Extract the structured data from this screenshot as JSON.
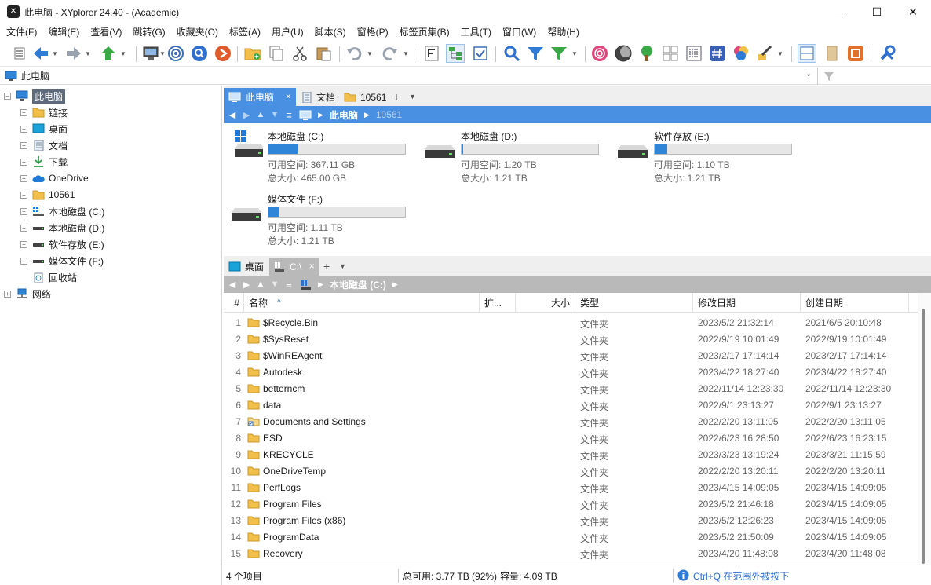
{
  "window": {
    "title": "此电脑 - XYplorer 24.40 - (Academic)",
    "min": "—",
    "max": "☐",
    "close": "✕"
  },
  "menu": [
    "文件(F)",
    "编辑(E)",
    "查看(V)",
    "跳转(G)",
    "收藏夹(O)",
    "标签(A)",
    "用户(U)",
    "脚本(S)",
    "窗格(P)",
    "标签页集(B)",
    "工具(T)",
    "窗口(W)",
    "帮助(H)"
  ],
  "address": {
    "text": "此电脑"
  },
  "tree": [
    {
      "label": "此电脑",
      "icon": "pc",
      "selected": true
    },
    {
      "label": "链接",
      "icon": "folder"
    },
    {
      "label": "桌面",
      "icon": "desktop"
    },
    {
      "label": "文档",
      "icon": "doc"
    },
    {
      "label": "下载",
      "icon": "download"
    },
    {
      "label": "OneDrive",
      "icon": "cloud"
    },
    {
      "label": "10561",
      "icon": "folder"
    },
    {
      "label": "本地磁盘 (C:)",
      "icon": "windrive"
    },
    {
      "label": "本地磁盘 (D:)",
      "icon": "drive"
    },
    {
      "label": "软件存放 (E:)",
      "icon": "drive"
    },
    {
      "label": "媒体文件 (F:)",
      "icon": "drive"
    },
    {
      "label": "回收站",
      "icon": "recycle"
    },
    {
      "label": "网络",
      "icon": "network"
    }
  ],
  "pane1": {
    "tabs": [
      "此电脑",
      "文档",
      "10561"
    ],
    "crumbs": [
      "此电脑",
      "10561"
    ],
    "drives": [
      {
        "name": "本地磁盘 (C:)",
        "free": "可用空间: 367.11 GB",
        "total": "总大小: 465.00 GB",
        "used": 0.21
      },
      {
        "name": "本地磁盘 (D:)",
        "free": "可用空间: 1.20 TB",
        "total": "总大小: 1.21 TB",
        "used": 0.01
      },
      {
        "name": "软件存放 (E:)",
        "free": "可用空间: 1.10 TB",
        "total": "总大小: 1.21 TB",
        "used": 0.09
      },
      {
        "name": "媒体文件 (F:)",
        "free": "可用空间: 1.11 TB",
        "total": "总大小: 1.21 TB",
        "used": 0.08
      }
    ]
  },
  "pane2": {
    "tabs": [
      "桌面",
      "C:\\"
    ],
    "crumbs": [
      "本地磁盘 (C:)"
    ],
    "columns": {
      "num": "#",
      "name": "名称",
      "ext": "扩...",
      "size": "大小",
      "type": "类型",
      "modified": "修改日期",
      "created": "创建日期"
    },
    "rows": [
      {
        "n": "1",
        "name": "$Recycle.Bin",
        "type": "文件夹",
        "mod": "2023/5/2 21:32:14",
        "cre": "2021/6/5 20:10:48"
      },
      {
        "n": "2",
        "name": "$SysReset",
        "type": "文件夹",
        "mod": "2022/9/19 10:01:49",
        "cre": "2022/9/19 10:01:49"
      },
      {
        "n": "3",
        "name": "$WinREAgent",
        "type": "文件夹",
        "mod": "2023/2/17 17:14:14",
        "cre": "2023/2/17 17:14:14"
      },
      {
        "n": "4",
        "name": "Autodesk",
        "type": "文件夹",
        "mod": "2023/4/22 18:27:40",
        "cre": "2023/4/22 18:27:40"
      },
      {
        "n": "5",
        "name": "betterncm",
        "type": "文件夹",
        "mod": "2022/11/14 12:23:30",
        "cre": "2022/11/14 12:23:30"
      },
      {
        "n": "6",
        "name": "data",
        "type": "文件夹",
        "mod": "2022/9/1 23:13:27",
        "cre": "2022/9/1 23:13:27"
      },
      {
        "n": "7",
        "name": "Documents and Settings",
        "type": "文件夹",
        "mod": "2022/2/20 13:11:05",
        "cre": "2022/2/20 13:11:05"
      },
      {
        "n": "8",
        "name": "ESD",
        "type": "文件夹",
        "mod": "2022/6/23 16:28:50",
        "cre": "2022/6/23 16:23:15"
      },
      {
        "n": "9",
        "name": "KRECYCLE",
        "type": "文件夹",
        "mod": "2023/3/23 13:19:24",
        "cre": "2023/3/21 11:15:59"
      },
      {
        "n": "10",
        "name": "OneDriveTemp",
        "type": "文件夹",
        "mod": "2022/2/20 13:20:11",
        "cre": "2022/2/20 13:20:11"
      },
      {
        "n": "11",
        "name": "PerfLogs",
        "type": "文件夹",
        "mod": "2023/4/15 14:09:05",
        "cre": "2023/4/15 14:09:05"
      },
      {
        "n": "12",
        "name": "Program Files",
        "type": "文件夹",
        "mod": "2023/5/2 21:46:18",
        "cre": "2023/4/15 14:09:05"
      },
      {
        "n": "13",
        "name": "Program Files (x86)",
        "type": "文件夹",
        "mod": "2023/5/2 12:26:23",
        "cre": "2023/4/15 14:09:05"
      },
      {
        "n": "14",
        "name": "ProgramData",
        "type": "文件夹",
        "mod": "2023/5/2 21:50:09",
        "cre": "2023/4/15 14:09:05"
      },
      {
        "n": "15",
        "name": "Recovery",
        "type": "文件夹",
        "mod": "2023/4/20 11:48:08",
        "cre": "2023/4/20 11:48:08"
      }
    ]
  },
  "status": {
    "items": "4 个项目",
    "free": "总可用: 3.77 TB (92%)",
    "capacity": "容量: 4.09 TB",
    "hint": "Ctrl+Q 在范围外被按下"
  },
  "colors": {
    "accent": "#4a90e2",
    "pane2": "#b9b9b9",
    "folder": "#f2c04a"
  }
}
